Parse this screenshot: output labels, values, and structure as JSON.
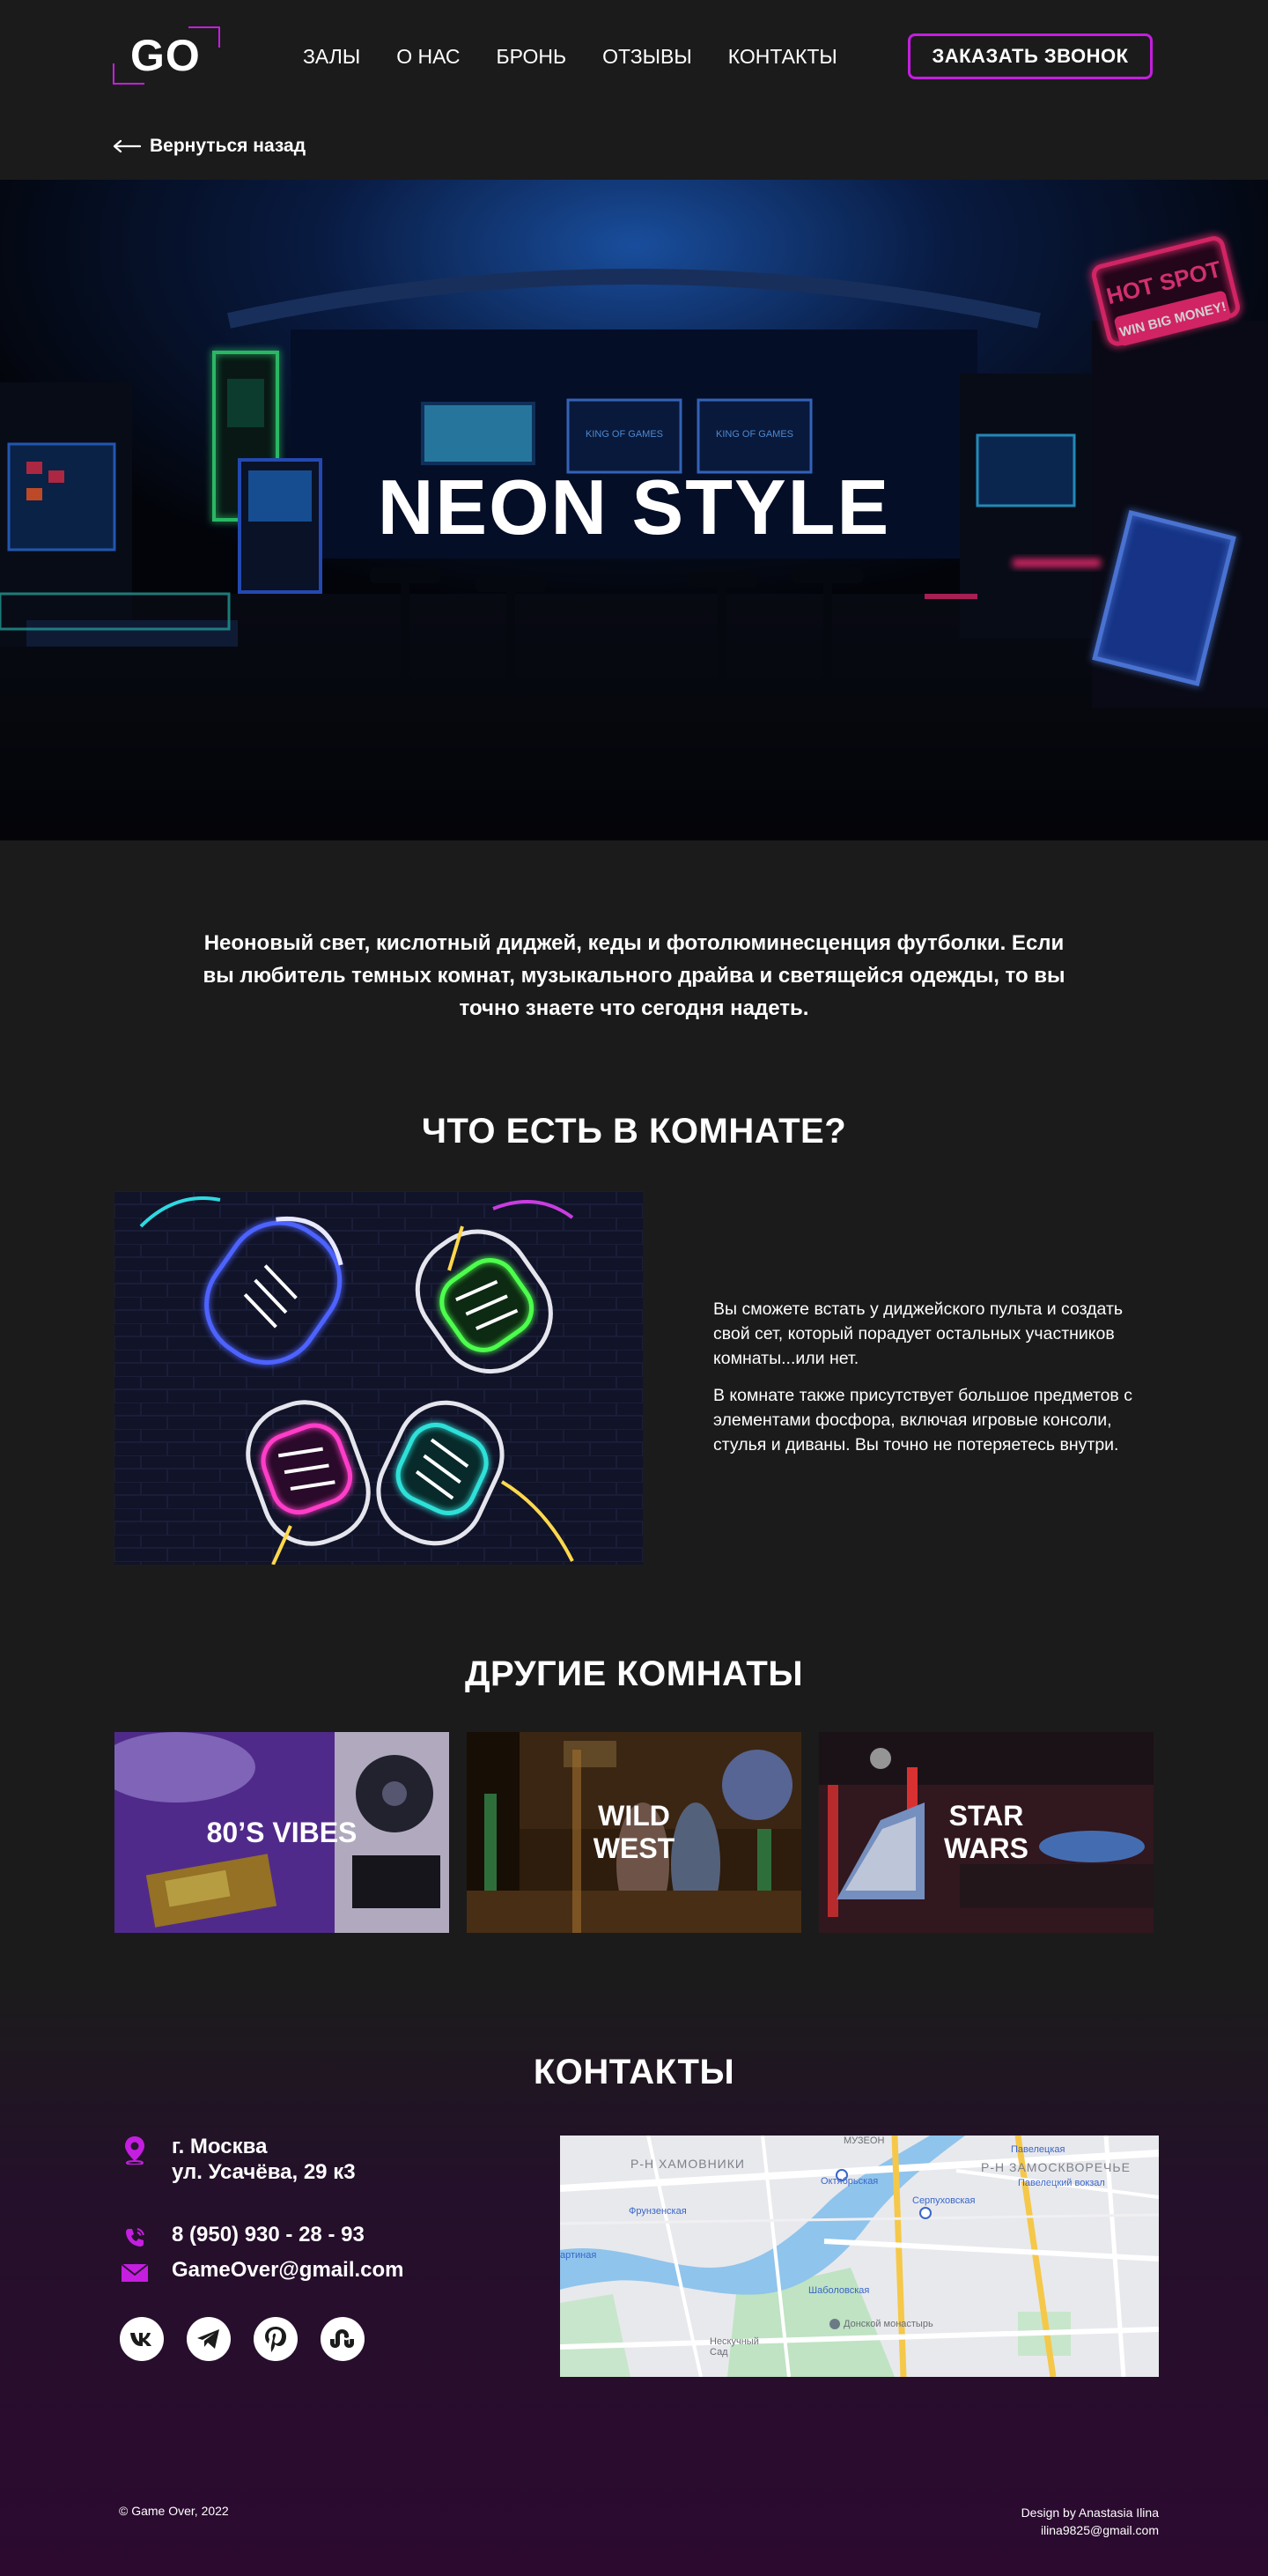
{
  "header": {
    "logo": "GO",
    "nav": [
      "ЗАЛЫ",
      "О НАС",
      "БРОНЬ",
      "ОТЗЫВЫ",
      "КОНТАКТЫ"
    ],
    "cta": "ЗАКАЗАТЬ ЗВОНОК",
    "back": "Вернуться назад"
  },
  "hero": {
    "title": "NEON STYLE",
    "screen_1": "KING OF GAMES",
    "screen_2": "KING OF GAMES",
    "sign_1": "HOT SPOT",
    "sign_2": "WIN BIG MONEY!"
  },
  "intro": "Неоновый свет, кислотный диджей, кеды и фотолюминесценция футболки. Если вы любитель темных комнат, музыкального драйва и светящейся одежды, то вы точно знаете что сегодня надеть.",
  "room": {
    "title": "ЧТО ЕСТЬ В КОМНАТЕ?",
    "paragraphs": [
      "Вы сможете встать у диджейского пульта и создать свой сет, который порадует остальных участников комнаты...или нет.",
      "В комнате также присутствует большое предметов с элементами фосфора, включая игровые консоли, стулья и диваны. Вы точно не потеряетесь внутри."
    ]
  },
  "other": {
    "title": "ДРУГИЕ КОМНАТЫ",
    "cards": [
      "80’S VIBES",
      "WILD\nWEST",
      "STAR\nWARS"
    ]
  },
  "contacts": {
    "title": "КОНТАКТЫ",
    "city": "г. Москва",
    "street": "ул. Усачёва, 29 к3",
    "phone": "8 (950) 930 - 28 - 93",
    "email": "GameOver@gmail.com",
    "social": [
      "vk-icon",
      "telegram-icon",
      "pinterest-icon",
      "stumbleupon-icon"
    ],
    "map_labels": [
      "Р-Н ХАМОВНИКИ",
      "Р-Н ЗАМОСКВОРЕЧЬЕ",
      "МУЗЕОН",
      "Октябрьская",
      "Фрунзенская",
      "Серпуховская",
      "Павелецкая",
      "Павелецкий вокзал",
      "Шаболовская",
      "Донской монастырь",
      "Нескучный Сад",
      "артиная"
    ]
  },
  "footer": {
    "copyright": "© Game Over, 2022",
    "design": "Design by Anastasia Ilina",
    "design_email": "ilina9825@gmail.com"
  },
  "colors": {
    "accent": "#c51ee0",
    "background": "#1b1b1b",
    "footer_bg": "#2c0a30"
  }
}
